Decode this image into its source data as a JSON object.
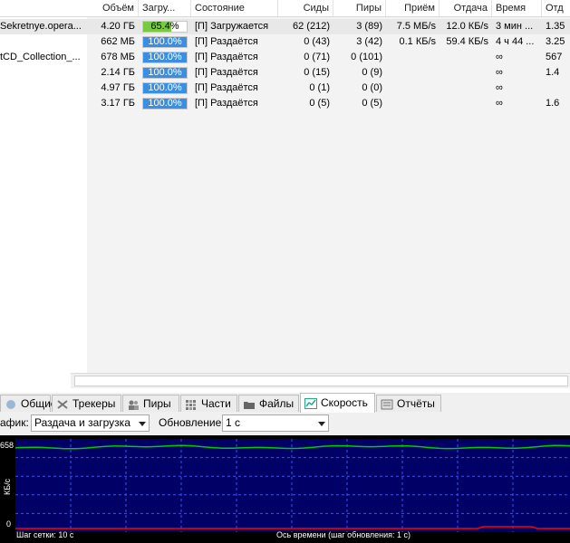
{
  "columns": {
    "size": "Объём",
    "done": "Загру...",
    "status": "Состояние",
    "seeds": "Сиды",
    "peers": "Пиры",
    "down": "Приём",
    "up": "Отдача",
    "eta": "Время",
    "ratio": "Отд"
  },
  "rows": [
    {
      "name": "Sekretnye.opera...",
      "size": "4.20 ГБ",
      "progress": 0.654,
      "done": "65.4%",
      "status": "[П] Загружается",
      "seeds": "62 (212)",
      "peers": "3 (89)",
      "down": "7.5 МБ/s",
      "up": "12.0 КБ/s",
      "eta": "3 мин ...",
      "ratio": "1.35"
    },
    {
      "name": "",
      "size": "662 МБ",
      "progress": 1.0,
      "done": "100.0%",
      "status": "[П] Раздаётся",
      "seeds": "0 (43)",
      "peers": "3 (42)",
      "down": "0.1 КБ/s",
      "up": "59.4 КБ/s",
      "eta": "4 ч 44 ...",
      "ratio": "3.25"
    },
    {
      "name": "tCD_Collection_...",
      "size": "678 МБ",
      "progress": 1.0,
      "done": "100.0%",
      "status": "[П] Раздаётся",
      "seeds": "0 (71)",
      "peers": "0 (101)",
      "down": "",
      "up": "",
      "eta": "∞",
      "ratio": "567"
    },
    {
      "name": "",
      "size": "2.14 ГБ",
      "progress": 1.0,
      "done": "100.0%",
      "status": "[П] Раздаётся",
      "seeds": "0 (15)",
      "peers": "0 (9)",
      "down": "",
      "up": "",
      "eta": "∞",
      "ratio": "1.4"
    },
    {
      "name": "",
      "size": "4.97 ГБ",
      "progress": 1.0,
      "done": "100.0%",
      "status": "[П] Раздаётся",
      "seeds": "0 (1)",
      "peers": "0 (0)",
      "down": "",
      "up": "",
      "eta": "∞",
      "ratio": ""
    },
    {
      "name": "",
      "size": "3.17 ГБ",
      "progress": 1.0,
      "done": "100.0%",
      "status": "[П] Раздаётся",
      "seeds": "0 (5)",
      "peers": "0 (5)",
      "down": "",
      "up": "",
      "eta": "∞",
      "ratio": "1.6"
    }
  ],
  "colors": {
    "progress_downloading": "#7ac943",
    "progress_seeding": "#3c8fe0",
    "graph_bg": "#000066",
    "upload_line": "#00cc00",
    "download_line": "#ff0000",
    "grid": "#3355ff"
  },
  "tabs": [
    {
      "label": "Общие",
      "icon": "info-icon"
    },
    {
      "label": "Трекеры",
      "icon": "trackers-icon"
    },
    {
      "label": "Пиры",
      "icon": "peers-icon"
    },
    {
      "label": "Части",
      "icon": "pieces-icon"
    },
    {
      "label": "Файлы",
      "icon": "folder-icon"
    },
    {
      "label": "Скорость",
      "icon": "speed-graph-icon",
      "active": true
    },
    {
      "label": "Отчёты",
      "icon": "logger-icon"
    }
  ],
  "controls": {
    "graph_label": "афик:",
    "graph_value": "Раздача и загрузка",
    "update_label": "Обновление",
    "update_value": "1 с"
  },
  "graph": {
    "y_max_label": "658",
    "y_min_label": "0",
    "y_axis_label": "КБ/с",
    "grid_step": "Шаг сетки: 10 с",
    "time_axis": "Ось времени (шаг обновления: 1 с)"
  }
}
